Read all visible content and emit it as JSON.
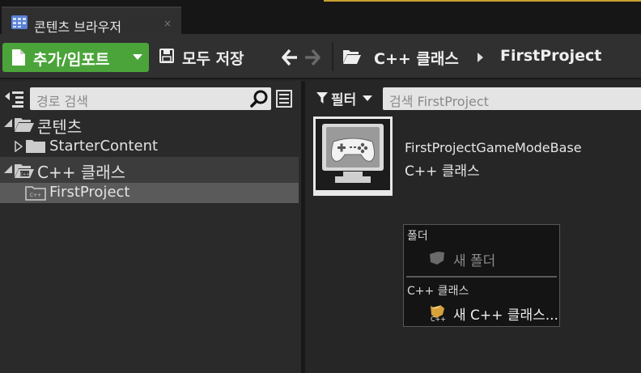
{
  "tab": {
    "title": "콘텐츠 브라우저",
    "close_glyph": "×",
    "icon": "content-browser-icon"
  },
  "toolbar": {
    "add_import_label": "추가/임포트",
    "save_all_label": "모두 저장",
    "accent_color": "#4ba43a"
  },
  "breadcrumb": {
    "root": "C++ 클래스",
    "leaf": "FirstProject"
  },
  "left_panel": {
    "search_placeholder": "경로 검색",
    "tree": [
      {
        "label": "콘텐츠",
        "expanded": true
      },
      {
        "label": "StarterContent",
        "expanded": false
      },
      {
        "label": "C++ 클래스",
        "expanded": true
      },
      {
        "label": "FirstProject",
        "selected": true
      }
    ]
  },
  "right_panel": {
    "filter_label": "필터",
    "search_placeholder": "검색 FirstProject",
    "assets": [
      {
        "name": "FirstProjectGameModeBase",
        "type": "C++ 클래스",
        "icon": "gamepad-monitor-icon"
      }
    ]
  },
  "context_menu": {
    "sections": [
      {
        "header": "폴더",
        "items": [
          {
            "label": "새 폴더",
            "enabled": false,
            "icon": "new-folder-icon"
          }
        ]
      },
      {
        "header": "C++ 클래스",
        "items": [
          {
            "label": "새 C++ 클래스...",
            "enabled": true,
            "icon": "new-cpp-class-icon"
          }
        ]
      }
    ]
  }
}
